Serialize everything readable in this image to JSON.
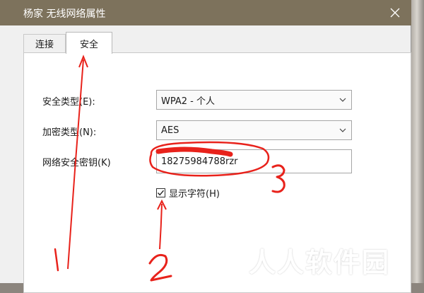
{
  "window": {
    "title": "杨家 无线网络属性",
    "close_symbol": "✕"
  },
  "tabs": [
    {
      "label": "连接",
      "active": false
    },
    {
      "label": "安全",
      "active": true
    }
  ],
  "form": {
    "security_type": {
      "label": "安全类型(E):",
      "value": "WPA2 - 个人"
    },
    "encryption_type": {
      "label": "加密类型(N):",
      "value": "AES"
    },
    "network_key": {
      "label": "网络安全密钥(K)",
      "value": "18275984788rzr"
    },
    "show_chars": {
      "label": "显示字符(H)",
      "checked": true
    }
  },
  "annotations": {
    "num_1": "1",
    "num_2": "2",
    "num_3": "3",
    "color": "#e8221b"
  },
  "watermark": {
    "text": "人人软件园"
  },
  "colors": {
    "titlebar": "#7d725c",
    "dialog_bg": "#f0f0f0",
    "panel_bg": "#ffffff"
  }
}
